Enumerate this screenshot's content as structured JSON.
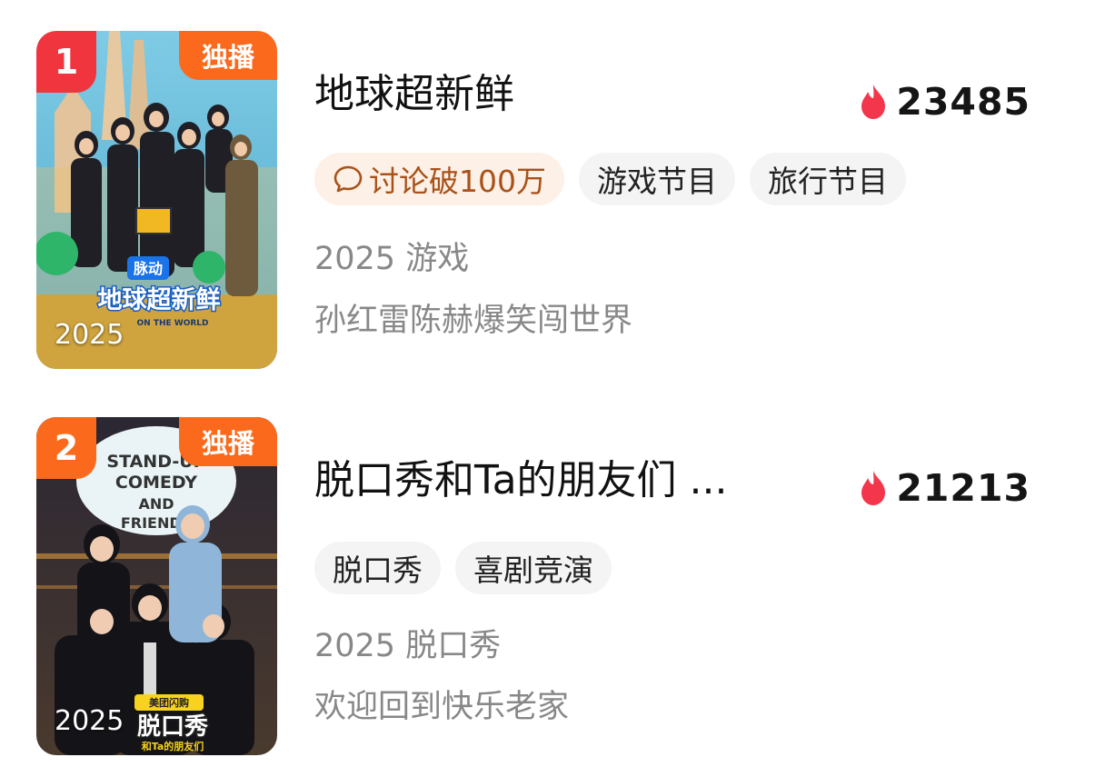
{
  "items": [
    {
      "rank": "1",
      "badge": "独播",
      "poster_year": "2025",
      "poster_title": "地球超新鲜",
      "poster_brand": "脉动",
      "poster_subtitle": "ON THE WORLD",
      "title": "地球超新鲜",
      "heat": "23485",
      "tags": [
        "讨论破100万",
        "游戏节目",
        "旅行节目"
      ],
      "meta": "2025 游戏",
      "desc": "孙红雷陈赫爆笑闯世界"
    },
    {
      "rank": "2",
      "badge": "独播",
      "poster_year": "2025",
      "poster_title": "脱口秀",
      "poster_brand": "美团闪购",
      "poster_subtitle": "和Ta的朋友们",
      "poster_sign": [
        "STAND-UP",
        "COMEDY",
        "AND",
        "FRIENDS"
      ],
      "title": "脱口秀和Ta的朋友们 ...",
      "heat": "21213",
      "tags": [
        "脱口秀",
        "喜剧竞演"
      ],
      "meta": "2025 脱口秀",
      "desc": "欢迎回到快乐老家"
    }
  ],
  "colors": {
    "rank1": "#f1353e",
    "rank2": "#fb6a1c",
    "badge": "#fb6a1c",
    "flame": "#f4364c",
    "hot_tag_bg": "#fdf0e6",
    "hot_tag_text": "#a8521a"
  },
  "icons": {
    "heat": "flame-icon",
    "discussion": "comment-bubble-icon"
  }
}
